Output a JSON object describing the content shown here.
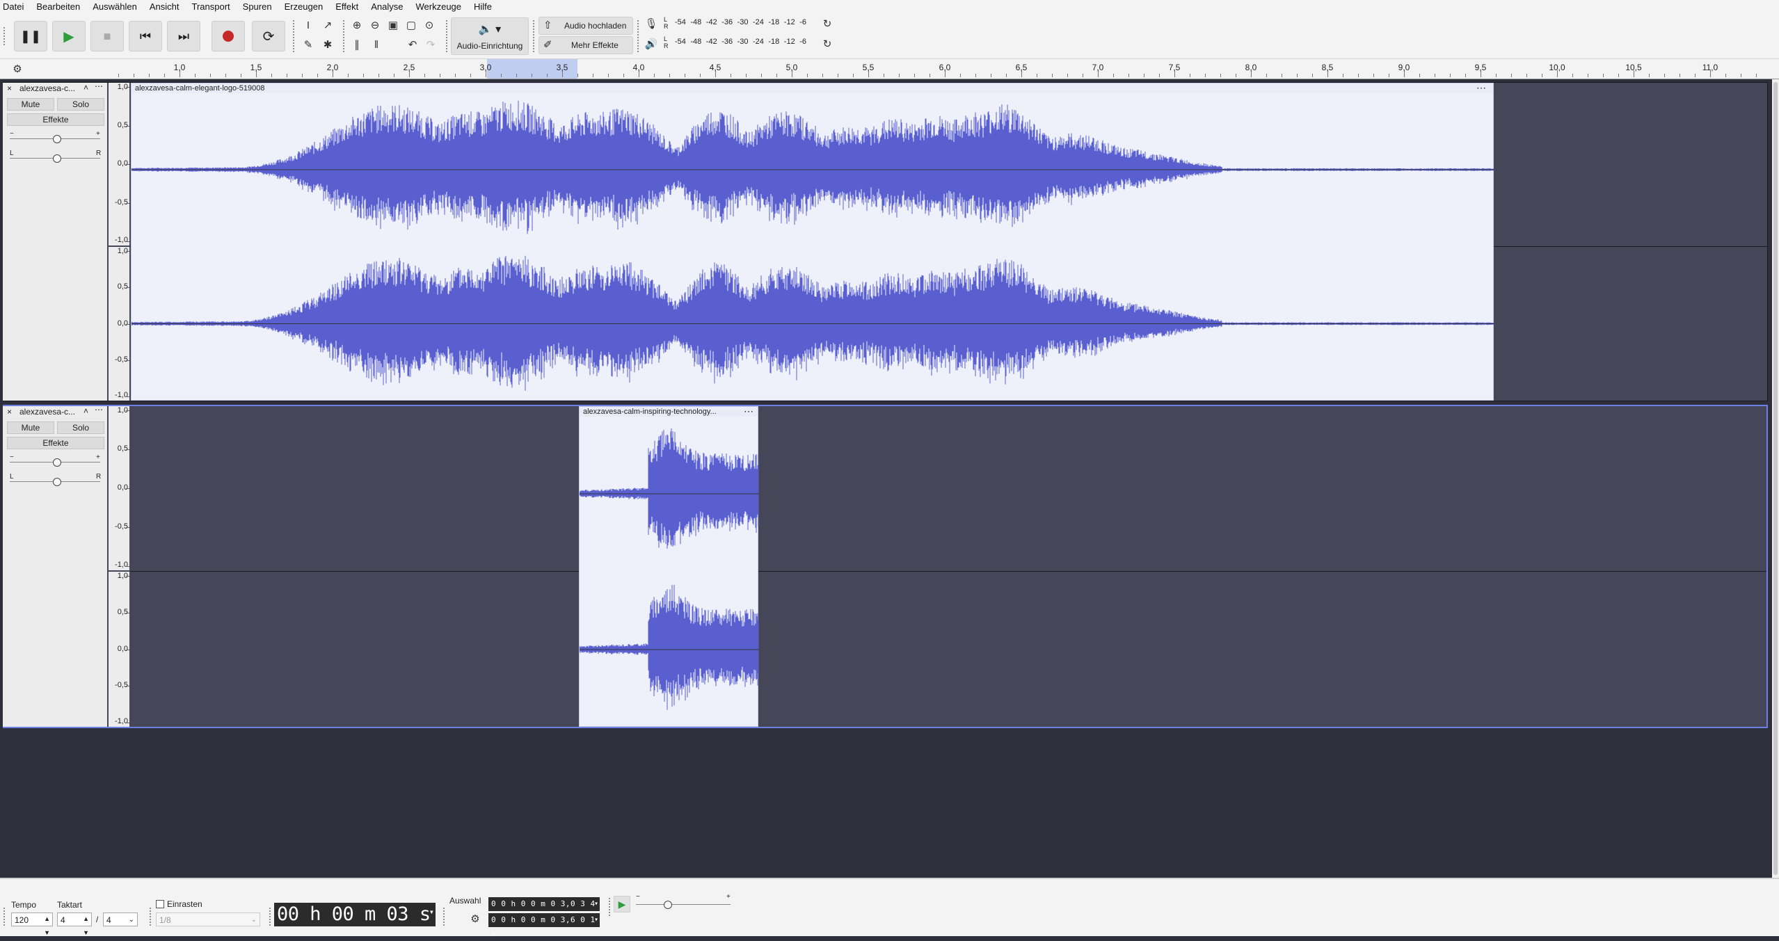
{
  "menu": [
    "Datei",
    "Bearbeiten",
    "Auswählen",
    "Ansicht",
    "Transport",
    "Spuren",
    "Erzeugen",
    "Effekt",
    "Analyse",
    "Werkzeuge",
    "Hilfe"
  ],
  "toolbar": {
    "audio_setup_label": "Audio-Einrichtung",
    "upload_label": "Audio hochladen",
    "more_effects_label": "Mehr Effekte",
    "meter_ticks": [
      "-54",
      "-48",
      "-42",
      "-36",
      "-30",
      "-24",
      "-18",
      "-12",
      "-6"
    ],
    "meter_lr_l": "L",
    "meter_lr_r": "R"
  },
  "ruler": {
    "labels": [
      "1,0",
      "1,5",
      "2,0",
      "2,5",
      "3,0",
      "3,5",
      "4,0",
      "4,5",
      "5,0",
      "5,5",
      "6,0",
      "6,5",
      "7,0",
      "7,5",
      "8,0",
      "8,5",
      "9,0",
      "9,5",
      "10,0",
      "10,5",
      "11,0"
    ]
  },
  "tracks": [
    {
      "name": "alexzavesa-c...",
      "mute": "Mute",
      "solo": "Solo",
      "effects": "Effekte",
      "clip_name": "alexzavesa-calm-elegant-logo-519008",
      "pan_l": "L",
      "pan_r": "R"
    },
    {
      "name": "alexzavesa-c...",
      "mute": "Mute",
      "solo": "Solo",
      "effects": "Effekte",
      "clip_name": "alexzavesa-calm-inspiring-technology...",
      "pan_l": "L",
      "pan_r": "R"
    }
  ],
  "scale_labels": [
    "1,0",
    "0,5",
    "0,0",
    "-0,5",
    "-1,0"
  ],
  "bottom": {
    "tempo_label": "Tempo",
    "tempo_value": "120",
    "taktart_label": "Taktart",
    "taktart_num": "4",
    "taktart_den": "4",
    "taktart_sep": "/",
    "snap_label": "Einrasten",
    "snap_value": "1/8",
    "time_display": "00 h 00 m 03 s",
    "selection_label": "Auswahl",
    "sel_start": "0 0 h 0 0 m 0 3,0 3 4 s",
    "sel_end": "0 0 h 0 0 m 0 3,6 0 1 s"
  },
  "colors": {
    "waveform": "#5a5fd0",
    "clip_bg": "#eef0fa",
    "track_bg": "#454759",
    "record": "#c62828",
    "play": "#2e9e3c"
  }
}
